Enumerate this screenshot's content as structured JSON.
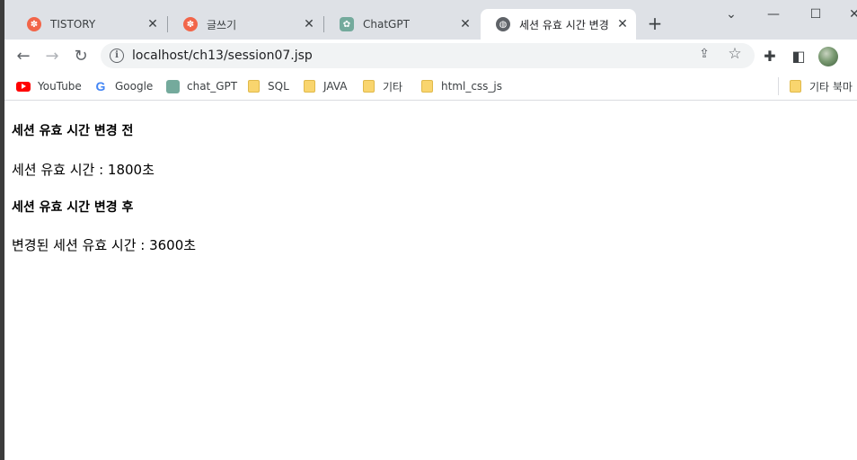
{
  "tabs": [
    {
      "title": "TISTORY",
      "favicon": "tistory-icon"
    },
    {
      "title": "글쓰기",
      "favicon": "tistory-icon"
    },
    {
      "title": "ChatGPT",
      "favicon": "chatgpt-icon"
    },
    {
      "title": "세션 유효 시간 변경",
      "favicon": "globe-icon",
      "active": true
    }
  ],
  "toolbar": {
    "url": "localhost/ch13/session07.jsp"
  },
  "bookmarks": [
    {
      "label": "YouTube",
      "icon": "youtube-icon"
    },
    {
      "label": "Google",
      "icon": "google-icon"
    },
    {
      "label": "chat_GPT",
      "icon": "chatgpt-icon"
    },
    {
      "label": "SQL",
      "icon": "folder-icon"
    },
    {
      "label": "JAVA",
      "icon": "folder-icon"
    },
    {
      "label": "기타",
      "icon": "folder-icon"
    },
    {
      "label": "html_css_js",
      "icon": "folder-icon"
    },
    {
      "label": "기타 북마",
      "icon": "folder-icon"
    }
  ],
  "page": {
    "heading_before": "세션 유효 시간 변경 전",
    "text_before": "세션 유효 시간 : 1800초",
    "heading_after": "세션 유효 시간 변경 후",
    "text_after": "변경된 세션 유효 시간 : 3600초"
  },
  "colors": {
    "tabstrip_bg": "#dee1e6",
    "omnibox_bg": "#f1f3f4",
    "folder": "#f9d56e"
  }
}
